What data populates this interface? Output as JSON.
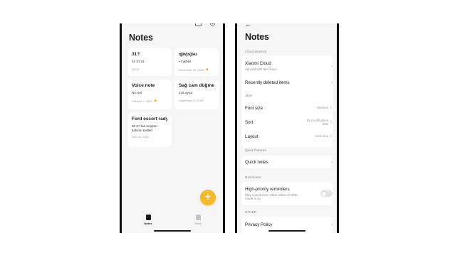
{
  "notes_screen": {
    "title": "Notes",
    "cards": [
      {
        "title": "31?",
        "body": "31 31 31",
        "date": "15:05"
      },
      {
        "title": "Voice note",
        "body": "No text",
        "date": "October 2, 2020",
        "reminder": true
      },
      {
        "title": "Ford escort rady…",
        "body": "92 87 fan müşürü kablolu kalitell",
        "date": "July 16, 2019"
      },
      {
        "title": "qjwjsjsu",
        "body": "• mjsbbs",
        "date": "December 19, 2020",
        "reminder": true
      },
      {
        "title": "Sağ cam düğme…",
        "body": "135 ayna",
        "date": "September 6, 2019"
      }
    ],
    "fab_label": "+",
    "tabs": [
      {
        "label": "Notes",
        "active": true
      },
      {
        "label": "Tasks",
        "active": false
      }
    ]
  },
  "settings_screen": {
    "back_icon": "back-arrow-icon",
    "title": "Notes",
    "sections": {
      "cloud": "Cloud services",
      "style": "Style",
      "quick": "Quick features",
      "reminders": "Reminders",
      "other": "OTHER"
    },
    "cloud_title": "Xiaomi Cloud",
    "cloud_sub": "Synced with the cloud",
    "recently_deleted": "Recently deleted items",
    "font_size_label": "Font size",
    "font_size_value": "Medium",
    "sort_label": "Sort",
    "sort_value_1": "By modification",
    "sort_value_2": "date",
    "layout_label": "Layout",
    "layout_value": "Grid view",
    "quick_notes": "Quick notes",
    "hp_title": "High-priority reminders",
    "hp_sub_1": "Play sound even when Silent or DND",
    "hp_sub_2": "mode is on",
    "hp_enabled": false,
    "privacy": "Privacy Policy"
  },
  "colors": {
    "accent": "#f5bb24",
    "background": "#f6f6f6",
    "card": "#ffffff"
  }
}
